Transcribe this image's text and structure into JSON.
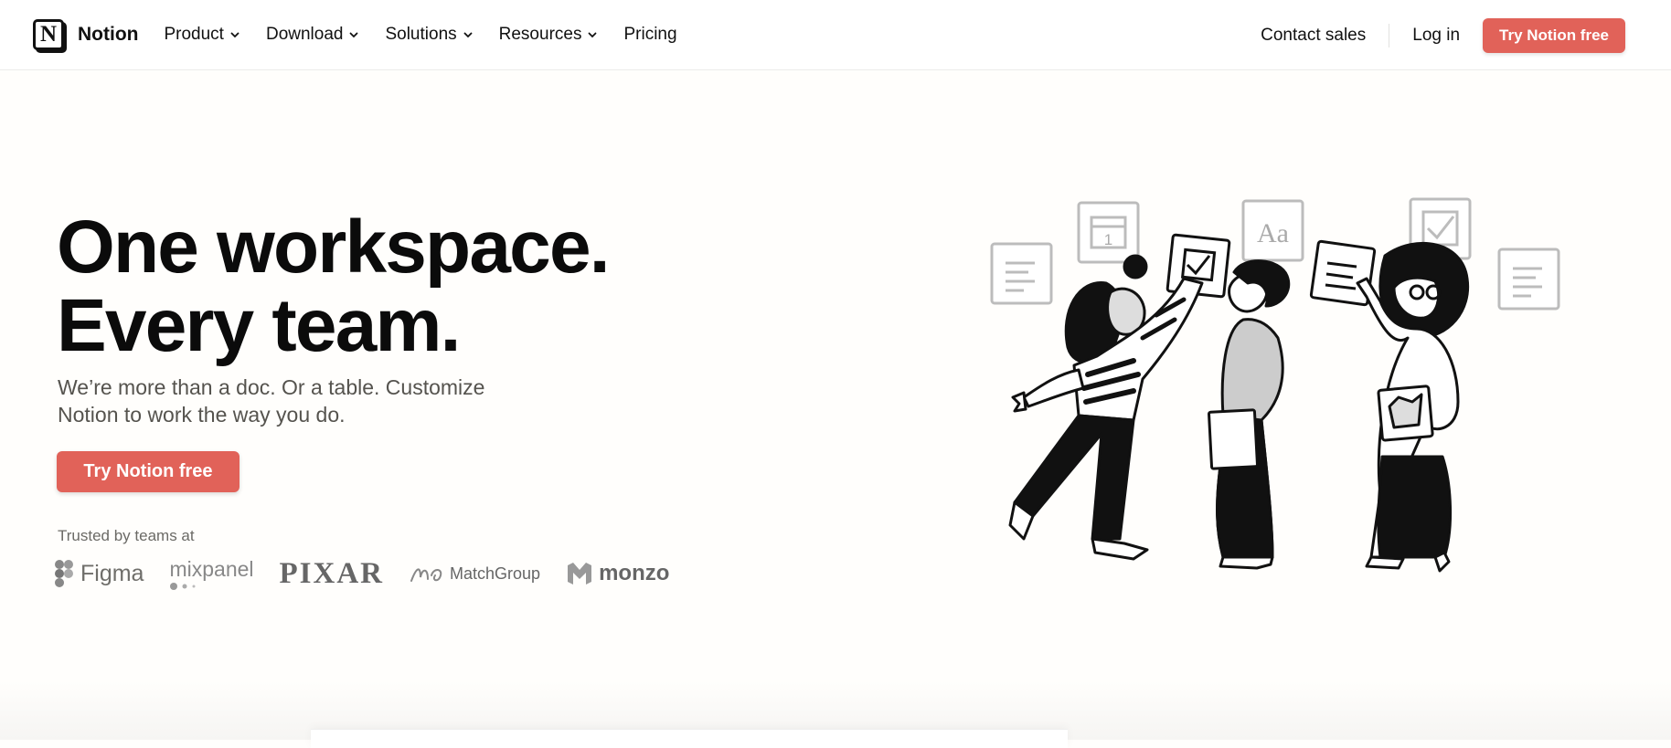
{
  "header": {
    "logo_mark": "N",
    "logo_text": "Notion",
    "nav": [
      {
        "label": "Product",
        "has_dropdown": true
      },
      {
        "label": "Download",
        "has_dropdown": true
      },
      {
        "label": "Solutions",
        "has_dropdown": true
      },
      {
        "label": "Resources",
        "has_dropdown": true
      },
      {
        "label": "Pricing",
        "has_dropdown": false
      }
    ],
    "contact_sales": "Contact sales",
    "log_in": "Log in",
    "cta": "Try Notion free"
  },
  "hero": {
    "title_line1": "One workspace.",
    "title_line2": "Every team.",
    "subtitle_line1": "We’re more than a doc. Or a table. Customize",
    "subtitle_line2": "Notion to work the way you do.",
    "cta": "Try Notion free",
    "trusted_label": "Trusted by teams at",
    "brands": [
      "Figma",
      "mixpanel",
      "PIXAR",
      "MatchGroup",
      "monzo"
    ],
    "illustration_card_text": "Aa",
    "illustration_calendar_day": "1"
  },
  "colors": {
    "accent": "#e16259",
    "text": "#111111",
    "muted": "#55534e",
    "background": "#fffefc"
  },
  "icons": [
    "chevron-down-icon",
    "notion-logo-icon",
    "figma-logo-icon",
    "mixpanel-logo-icon",
    "matchgroup-logo-icon",
    "monzo-logo-icon"
  ]
}
